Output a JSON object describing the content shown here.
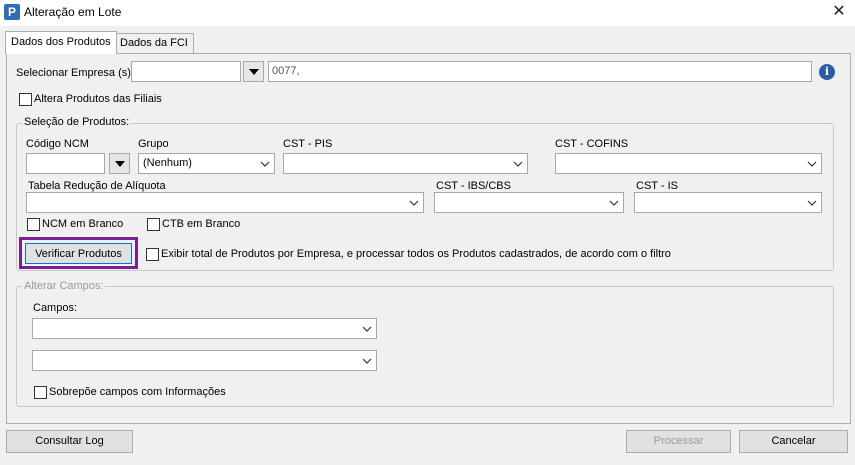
{
  "window": {
    "title": "Alteração em Lote",
    "close_symbol": "✕",
    "icon_letter": "P"
  },
  "tabs": [
    {
      "label": "Dados dos Produtos",
      "active": true
    },
    {
      "label": "Dados da FCI",
      "active": false
    }
  ],
  "empresa": {
    "label": "Selecionar Empresa (s):",
    "input_value": "",
    "selected_text": "0077,"
  },
  "filiais": {
    "label": "Altera Produtos das Filiais",
    "checked": false
  },
  "selecao": {
    "title": "Seleção de Produtos:",
    "ncm_label": "Código NCM",
    "ncm_value": "",
    "grupo_label": "Grupo",
    "grupo_value": "(Nenhum)",
    "cst_pis_label": "CST - PIS",
    "cst_pis_value": "",
    "cst_cofins_label": "CST - COFINS",
    "cst_cofins_value": "",
    "tabela_label": "Tabela Redução de Alíquota",
    "tabela_value": "",
    "cst_ibs_label": "CST - IBS/CBS",
    "cst_ibs_value": "",
    "cst_is_label": "CST - IS",
    "cst_is_value": "",
    "ncm_branco_label": "NCM em Branco",
    "ctb_branco_label": "CTB em Branco",
    "verificar_label": "Verificar Produtos",
    "exibir_label": "Exibir total de Produtos por Empresa, e processar todos os Produtos cadastrados, de acordo com o filtro"
  },
  "alterar": {
    "title": "Alterar Campos:",
    "campos_label": "Campos:",
    "campos_value_1": "",
    "campos_value_2": "",
    "sobrepoe_label": "Sobrepõe campos com Informações"
  },
  "footer": {
    "consultar_log_label": "Consultar Log",
    "processar_label": "Processar",
    "cancelar_label": "Cancelar"
  },
  "colors": {
    "highlight": "#7a1f8f",
    "info_icon": "#2a5ea8"
  }
}
